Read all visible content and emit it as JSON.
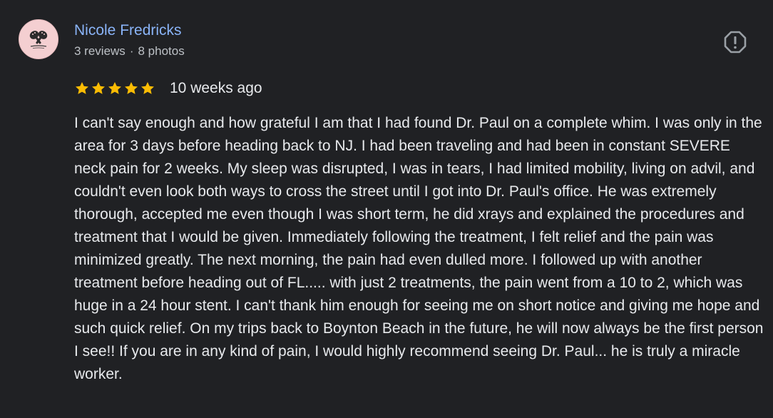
{
  "review": {
    "author": {
      "name": "Nicole Fredricks",
      "reviews": "3 reviews",
      "separator": "·",
      "photos": "8 photos"
    },
    "rating": 5,
    "date": "10 weeks ago",
    "text": "I can't say enough and how grateful I am that I had found Dr. Paul on a complete whim. I was only in the area for 3 days before heading back to NJ. I had been traveling and had been in constant SEVERE neck pain for 2 weeks. My sleep was disrupted, I was in tears, I had limited mobility, living on advil, and couldn't even look both ways to cross the street until I got into Dr. Paul's office. He was extremely thorough, accepted me even though I was short term, he did xrays and explained the procedures and treatment that I would be given. Immediately following the treatment, I felt relief and the pain was minimized greatly. The next morning, the pain had even dulled more. I followed up with another treatment before heading out of FL..... with just 2 treatments, the pain went from a 10 to 2, which was huge in a 24 hour stent. I can't thank him enough for seeing me on short notice and giving me hope and such quick relief. On my trips back to Boynton Beach in the future, he will now always be the first person I see!! If you are in any kind of pain, I would highly recommend seeing Dr. Paul... he is truly a miracle worker."
  },
  "icons": {
    "avatar": "avatar-logo-icon",
    "report": "report-flag-icon",
    "star": "star-icon"
  },
  "colors": {
    "background": "#202124",
    "author_link": "#8ab4f8",
    "meta_text": "#bdc1c6",
    "body_text": "#e8eaed",
    "star": "#fbbc04",
    "icon": "#9aa0a6"
  }
}
